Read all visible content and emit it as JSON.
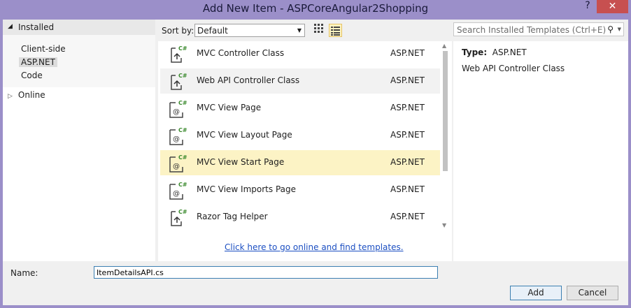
{
  "window": {
    "title": "Add New Item - ASPCoreAngular2Shopping",
    "help_label": "?",
    "close_label": "✕"
  },
  "tree": {
    "installed_label": "Installed",
    "items": [
      {
        "label": "Client-side"
      },
      {
        "label": "ASP.NET"
      },
      {
        "label": "Code"
      }
    ],
    "online_label": "Online"
  },
  "sort": {
    "label": "Sort by:",
    "value": "Default"
  },
  "search": {
    "placeholder": "Search Installed Templates (Ctrl+E)"
  },
  "templates": [
    {
      "name": "MVC Controller Class",
      "type": "ASP.NET",
      "icon": "controller-class-icon"
    },
    {
      "name": "Web API Controller Class",
      "type": "ASP.NET",
      "icon": "controller-class-icon"
    },
    {
      "name": "MVC View Page",
      "type": "ASP.NET",
      "icon": "razor-view-icon"
    },
    {
      "name": "MVC View Layout Page",
      "type": "ASP.NET",
      "icon": "razor-view-icon"
    },
    {
      "name": "MVC View Start Page",
      "type": "ASP.NET",
      "icon": "razor-view-icon"
    },
    {
      "name": "MVC View Imports Page",
      "type": "ASP.NET",
      "icon": "razor-view-icon"
    },
    {
      "name": "Razor Tag Helper",
      "type": "ASP.NET",
      "icon": "controller-class-icon"
    }
  ],
  "online_link": "Click here to go online and find templates.",
  "details": {
    "type_label": "Type:",
    "type_value": "ASP.NET",
    "description": "Web API Controller Class"
  },
  "name_field": {
    "label": "Name:",
    "value": "ItemDetailsAPI.cs"
  },
  "buttons": {
    "add": "Add",
    "cancel": "Cancel"
  },
  "colors": {
    "accent": "#9b8fc9",
    "selected_row": "#fcf3c5",
    "link": "#1c4fc2",
    "close": "#c75050"
  }
}
